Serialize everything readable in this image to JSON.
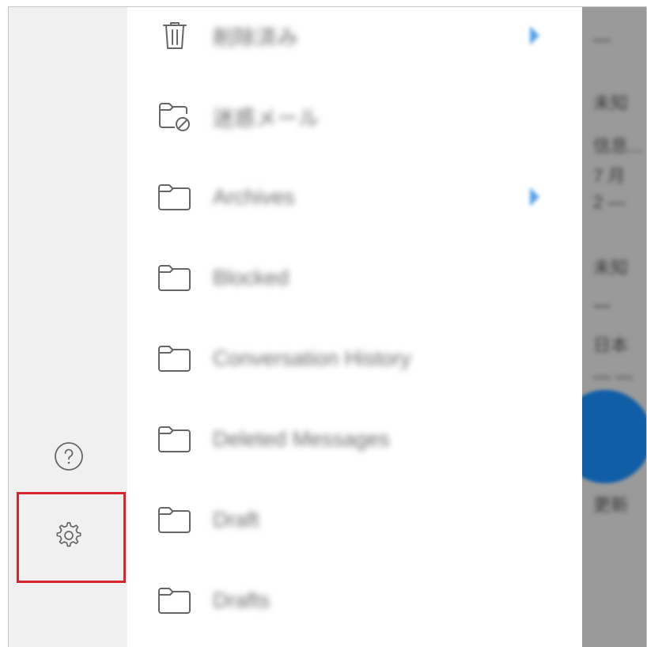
{
  "sidebar": {
    "help_icon": "help-circle-icon",
    "settings_icon": "gear-icon"
  },
  "folders": [
    {
      "label": "削除済み",
      "icon": "trash-icon",
      "has_children": true
    },
    {
      "label": "迷惑メール",
      "icon": "blocked-folder-icon",
      "has_children": false
    },
    {
      "label": "Archives",
      "icon": "folder-icon",
      "has_children": true
    },
    {
      "label": "Blocked",
      "icon": "folder-icon",
      "has_children": false
    },
    {
      "label": "Conversation History",
      "icon": "folder-icon",
      "has_children": false
    },
    {
      "label": "Deleted Messages",
      "icon": "folder-icon",
      "has_children": false
    },
    {
      "label": "Draft",
      "icon": "folder-icon",
      "has_children": false
    },
    {
      "label": "Drafts",
      "icon": "folder-icon",
      "has_children": false
    }
  ],
  "background": {
    "snippets": [
      "—",
      "未知",
      "信息...",
      "7 月",
      "2 —",
      "未知",
      "一",
      "日本",
      "— —",
      "更新"
    ]
  },
  "colors": {
    "highlight": "#d6262b",
    "chevron": "#5aa3e8",
    "fab": "#0f5ea6",
    "rail": "#f0f0f0"
  }
}
